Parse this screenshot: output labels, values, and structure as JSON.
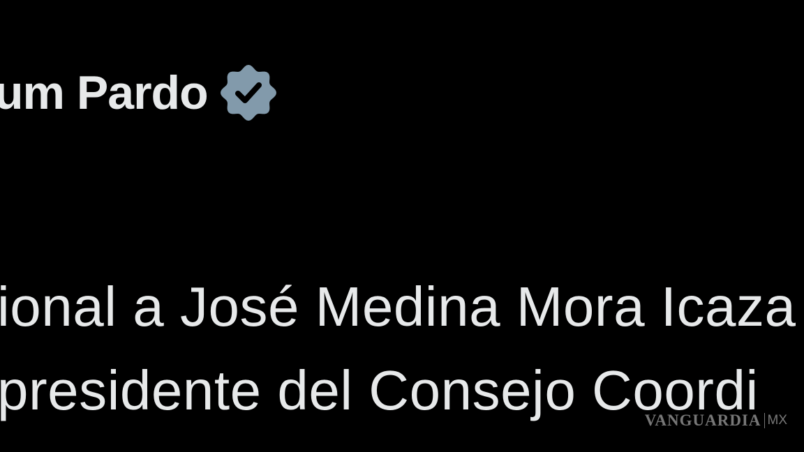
{
  "post": {
    "author_name": "um Pardo",
    "verified_icon": "verified-badge-icon",
    "badge_color": "#829aab",
    "lines": [
      "ional a José Medina Mora Icaza",
      "presidente del Consejo Coordi"
    ]
  },
  "watermark": {
    "brand": "VANGUARDIA",
    "region": "MX"
  }
}
